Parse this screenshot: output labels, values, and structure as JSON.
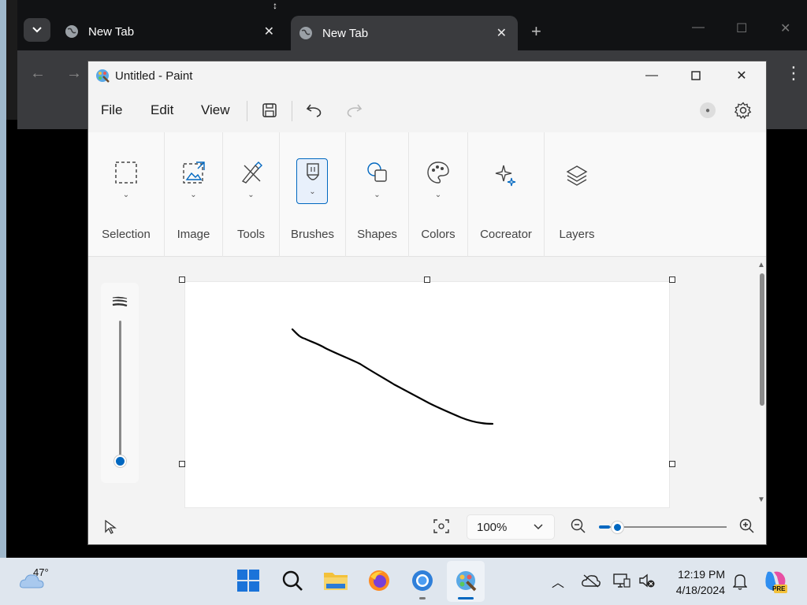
{
  "browser": {
    "tabs": [
      {
        "label": "New Tab"
      },
      {
        "label": "New Tab"
      }
    ]
  },
  "paint": {
    "title": "Untitled - Paint",
    "menu": {
      "file": "File",
      "edit": "Edit",
      "view": "View"
    },
    "ribbon": [
      {
        "label": "Selection",
        "icon": "selection-icon"
      },
      {
        "label": "Image",
        "icon": "image-icon"
      },
      {
        "label": "Tools",
        "icon": "tools-icon"
      },
      {
        "label": "Brushes",
        "icon": "brush-icon"
      },
      {
        "label": "Shapes",
        "icon": "shapes-icon"
      },
      {
        "label": "Colors",
        "icon": "palette-icon"
      },
      {
        "label": "Cocreator",
        "icon": "sparkle-icon"
      },
      {
        "label": "Layers",
        "icon": "layers-icon"
      }
    ],
    "zoom": "100%",
    "brush_size_level": 0.0
  },
  "taskbar": {
    "weather_temp": "47°",
    "time": "12:19 PM",
    "date": "4/18/2024"
  },
  "colors": {
    "accent": "#0067c0",
    "ribbon_bg": "#f9f9f9",
    "taskbar_bg": "#dfe6ee"
  }
}
